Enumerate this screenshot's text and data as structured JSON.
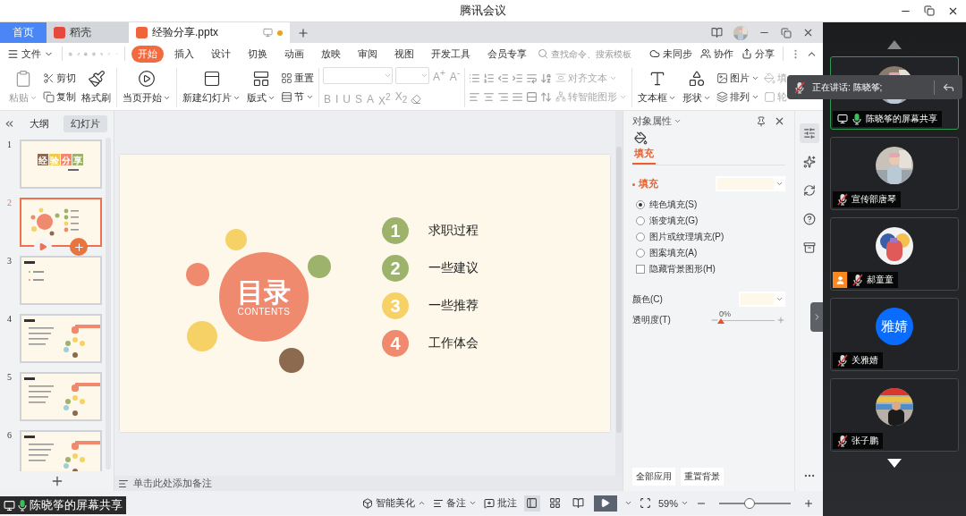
{
  "title_bar": {
    "title": "腾讯会议"
  },
  "tabs": [
    {
      "label": "首页",
      "kind": "home",
      "selected": false,
      "unsaved": false
    },
    {
      "label": "稻壳",
      "kind": "store",
      "selected": false,
      "unsaved": false
    },
    {
      "label": "经验分享.pptx",
      "kind": "document",
      "selected": true,
      "unsaved": true
    }
  ],
  "menu": {
    "file": "文件",
    "tabs": [
      {
        "label": "开始",
        "selected": true
      },
      {
        "label": "插入",
        "selected": false
      },
      {
        "label": "设计",
        "selected": false
      },
      {
        "label": "切换",
        "selected": false
      },
      {
        "label": "动画",
        "selected": false
      },
      {
        "label": "放映",
        "selected": false
      },
      {
        "label": "审阅",
        "selected": false
      },
      {
        "label": "视图",
        "selected": false
      },
      {
        "label": "开发工具",
        "selected": false
      },
      {
        "label": "会员专享",
        "selected": false
      }
    ],
    "search": {
      "placeholder": "查找命令、搜索模板"
    },
    "actions": [
      "未同步",
      "协作",
      "分享"
    ]
  },
  "ribbon": {
    "sections": [
      [
        {
          "kind": "large",
          "label": "粘贴",
          "dropdown": true,
          "disabled": true
        },
        {
          "kind": "stack",
          "items": [
            {
              "label": "剪切",
              "dropdown": false,
              "disabled": false
            },
            {
              "label": "复制",
              "dropdown": false,
              "disabled": false
            }
          ]
        },
        {
          "kind": "large",
          "label": "格式刷",
          "dropdown": false,
          "disabled": false
        }
      ],
      [
        {
          "kind": "large",
          "label": "当页开始",
          "dropdown": true,
          "disabled": false
        }
      ],
      [
        {
          "kind": "large",
          "label": "新建幻灯片",
          "dropdown": true,
          "disabled": false
        },
        {
          "kind": "large",
          "label": "版式",
          "dropdown": true,
          "disabled": false
        },
        {
          "kind": "stack",
          "items": [
            {
              "label": "重置",
              "dropdown": false,
              "disabled": false
            },
            {
              "label": "节",
              "dropdown": true,
              "disabled": false
            }
          ]
        }
      ],
      [
        {
          "kind": "font",
          "disabled": true,
          "size_buttons": [
            "A$^{+}$",
            "A$^{-}$"
          ],
          "format_buttons": [
            "B",
            "I",
            "U",
            "S",
            "A",
            "X$^{2}$",
            "X$_{2}$"
          ]
        }
      ],
      [
        {
          "kind": "paragraph",
          "items": [
            {
              "label": "对齐文本",
              "dropdown": true,
              "disabled": true
            },
            {
              "label": "转智能图形",
              "dropdown": true,
              "disabled": true
            }
          ]
        }
      ],
      [
        {
          "kind": "large",
          "label": "文本框",
          "dropdown": true,
          "disabled": false
        },
        {
          "kind": "large",
          "label": "形状",
          "dropdown": true,
          "disabled": false
        },
        {
          "kind": "stack",
          "items": [
            {
              "label": "图片",
              "dropdown": true,
              "disabled": false
            },
            {
              "label": "排列",
              "dropdown": true,
              "disabled": false
            }
          ]
        },
        {
          "kind": "stack",
          "items": [
            {
              "label": "填",
              "dropdown": false,
              "disabled": true
            },
            {
              "label": "轮",
              "dropdown": false,
              "disabled": true
            }
          ]
        }
      ]
    ]
  },
  "slides_panel": {
    "tabs": [
      {
        "label": "大纲",
        "selected": false
      },
      {
        "label": "幻灯片",
        "selected": true
      }
    ],
    "slides": [
      {
        "number": "1",
        "kind": "title",
        "selected": false,
        "title_tiles": [
          "经",
          "验",
          "分",
          "享"
        ]
      },
      {
        "number": "2",
        "kind": "contents",
        "selected": true
      },
      {
        "number": "3",
        "kind": "list",
        "selected": false
      },
      {
        "number": "4",
        "kind": "tap",
        "selected": false
      },
      {
        "number": "5",
        "kind": "tap",
        "selected": false
      },
      {
        "number": "6",
        "kind": "tap",
        "selected": false
      }
    ]
  },
  "slide": {
    "title": "目录",
    "subtitle": "CONTENTS",
    "items": [
      {
        "number": "1",
        "label": "求职过程",
        "color": "#9db36b"
      },
      {
        "number": "2",
        "label": "一些建议",
        "color": "#9db36b"
      },
      {
        "number": "3",
        "label": "一些推荐",
        "color": "#f6d266"
      },
      {
        "number": "4",
        "label": "工作体会",
        "color": "#ef8a6f"
      }
    ]
  },
  "notes": {
    "placeholder": "单击此处添加备注"
  },
  "properties": {
    "title": "对象属性",
    "tabs": [
      {
        "label": "填充",
        "selected": true
      }
    ],
    "section": "填充",
    "options": [
      {
        "label": "纯色填充(S)",
        "selected": true
      },
      {
        "label": "渐变填充(G)",
        "selected": false
      },
      {
        "label": "图片或纹理填充(P)",
        "selected": false
      },
      {
        "label": "图案填充(A)",
        "selected": false
      }
    ],
    "hide_background": {
      "label": "隐藏背景图形(H)",
      "checked": false
    },
    "color_label": "颜色(C)",
    "transparency": {
      "label": "透明度(T)",
      "level": 0,
      "reading": "0%"
    },
    "buttons": [
      "全部应用",
      "重置背景"
    ]
  },
  "status_bar": {
    "beautify": "智能美化",
    "notes": "备注",
    "comments": "批注",
    "views": [
      {
        "kind": "normal",
        "selected": true
      },
      {
        "kind": "sorter",
        "selected": false
      },
      {
        "kind": "reading",
        "selected": false
      }
    ],
    "zoom": "59%",
    "zoom_slider": {
      "level": 0.42
    }
  },
  "meeting": {
    "speaking": "正在讲话: 陈晓筝;",
    "participants": [
      {
        "name": "陈晓筝的屏幕共享",
        "selected": true,
        "muted": false,
        "sharing": true,
        "host_badge": false
      },
      {
        "name": "宣传部唐琴",
        "selected": false,
        "muted": true,
        "sharing": false,
        "host_badge": false
      },
      {
        "name": "郝童童",
        "selected": false,
        "muted": true,
        "sharing": false,
        "host_badge": true
      },
      {
        "name": "关雅婧",
        "selected": false,
        "muted": true,
        "sharing": false,
        "host_badge": false,
        "avatar": {
          "kind": "text",
          "text": "雅婧"
        }
      },
      {
        "name": "张子鹏",
        "selected": false,
        "muted": true,
        "sharing": false,
        "host_badge": false
      }
    ]
  },
  "screen_share_badge": "陈晓筝的屏幕共享"
}
